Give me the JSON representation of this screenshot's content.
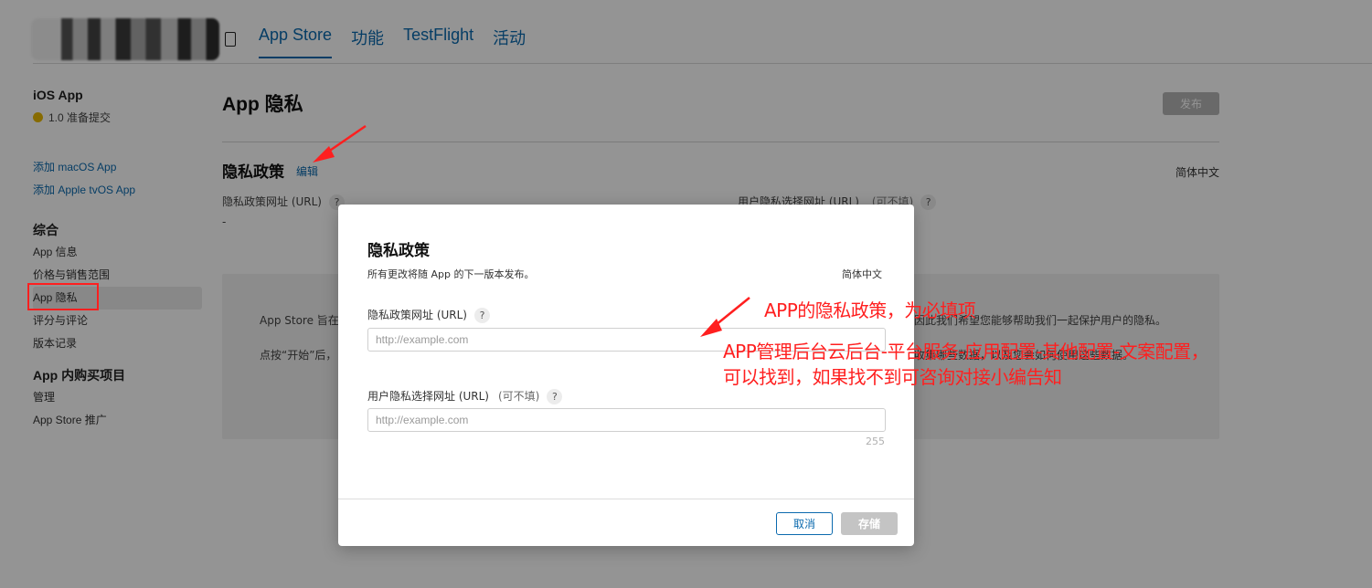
{
  "nav": {
    "tabs": [
      "App Store",
      "功能",
      "TestFlight",
      "活动"
    ],
    "active_tab": "App Store"
  },
  "sidebar": {
    "title": "iOS App",
    "version_status": "1.0 准备提交",
    "status_color": "#e8b800",
    "add_links": [
      "添加 macOS App",
      "添加 Apple tvOS App"
    ],
    "general_heading": "综合",
    "general_items": [
      "App 信息",
      "价格与销售范围",
      "App 隐私",
      "评分与评论",
      "版本记录"
    ],
    "selected_item": "App 隐私",
    "iap_heading": "App 内购买项目",
    "iap_items": [
      "管理",
      "App Store 推广"
    ]
  },
  "main": {
    "title": "App 隐私",
    "publish_label": "发布",
    "section_title": "隐私政策",
    "edit_label": "编辑",
    "language": "简体中文",
    "policy_url_label": "隐私政策网址 (URL)",
    "policy_url_value": "-",
    "choice_url_label": "用户隐私选择网址 (URL)",
    "optional_label": "(可不填)",
    "help_glyph": "?",
    "info_line1_start": "App Store 旨在为",
    "info_line1_end": "因此我们希望您能够帮助我们一起保护用户的隐私。",
    "info_line2_start": "点按“开始”后，",
    "info_line2_end": "收集哪些数据，以及您会如何使用这些数据。"
  },
  "modal": {
    "title": "隐私政策",
    "description": "所有更改将随 App 的下一版本发布。",
    "language": "简体中文",
    "policy_url_label": "隐私政策网址 (URL)",
    "policy_url_placeholder": "http://example.com",
    "choice_url_label": "用户隐私选择网址 (URL)",
    "optional_label": "(可不填)",
    "choice_url_placeholder": "http://example.com",
    "char_count": "255",
    "cancel_label": "取消",
    "save_label": "存储"
  },
  "annotations": {
    "line1": "APP的隐私政策，为必填项",
    "line2": "APP管理后台云后台-平台服务-应用配置-其他配置-文案配置，",
    "line3": "可以找到，如果找不到可咨询对接小编告知",
    "color": "#ff1f1f"
  }
}
